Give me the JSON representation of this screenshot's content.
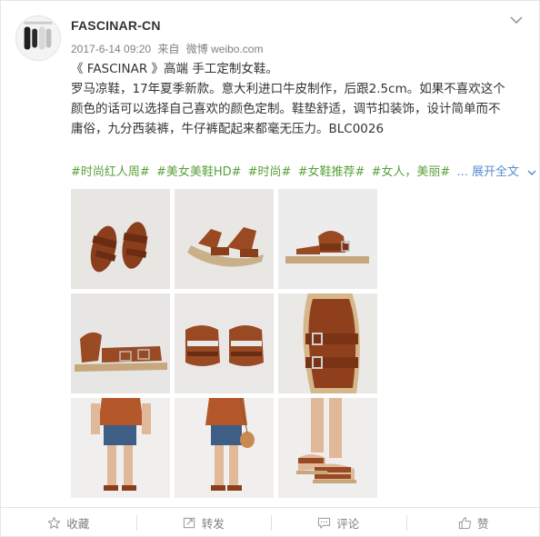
{
  "post": {
    "username": "FASCINAR-CN",
    "timestamp": "2017-6-14 09:20",
    "source_prefix": "来自",
    "source": "微博 weibo.com",
    "text_lines": [
      "《 FASCINAR 》高端 手工定制女鞋。",
      "罗马凉鞋，17年夏季新款。意大利进口牛皮制作，后跟2.5cm。如果不喜欢这个",
      "颜色的话可以选择自己喜欢的颜色定制。鞋垫舒适，调节扣装饰，设计简单而不",
      "庸俗，九分西装裤，牛仔裤配起来都毫无压力。BLC0026"
    ],
    "tags": [
      "#时尚红人周#",
      "#美女美鞋HD#",
      "#时尚#",
      "#女鞋推荐#",
      "#女人，美丽#"
    ],
    "ellipsis": "...",
    "expand_label": "展开全文"
  },
  "photos": [
    {
      "name": "photo-1",
      "desc": "sandal-pair-top-view"
    },
    {
      "name": "photo-2",
      "desc": "sandal-pair-angle"
    },
    {
      "name": "photo-3",
      "desc": "sandal-side-view"
    },
    {
      "name": "photo-4",
      "desc": "sandal-side-detail"
    },
    {
      "name": "photo-5",
      "desc": "sandal-pair-front"
    },
    {
      "name": "photo-6",
      "desc": "sandal-buckle-closeup"
    },
    {
      "name": "photo-7",
      "desc": "model-front"
    },
    {
      "name": "photo-8",
      "desc": "model-back"
    },
    {
      "name": "photo-9",
      "desc": "model-feet"
    }
  ],
  "actions": {
    "favorite": "收藏",
    "repost": "转发",
    "comment": "评论",
    "like": "赞"
  },
  "colors": {
    "tag": "#5aa13a",
    "link": "#5a8dcf",
    "meta": "#808080",
    "leather": "#9a4a22"
  },
  "icons": {
    "favorite": "star-icon",
    "repost": "repost-icon",
    "comment": "comment-icon",
    "like": "thumbs-up-icon",
    "menu": "chevron-down-icon"
  }
}
